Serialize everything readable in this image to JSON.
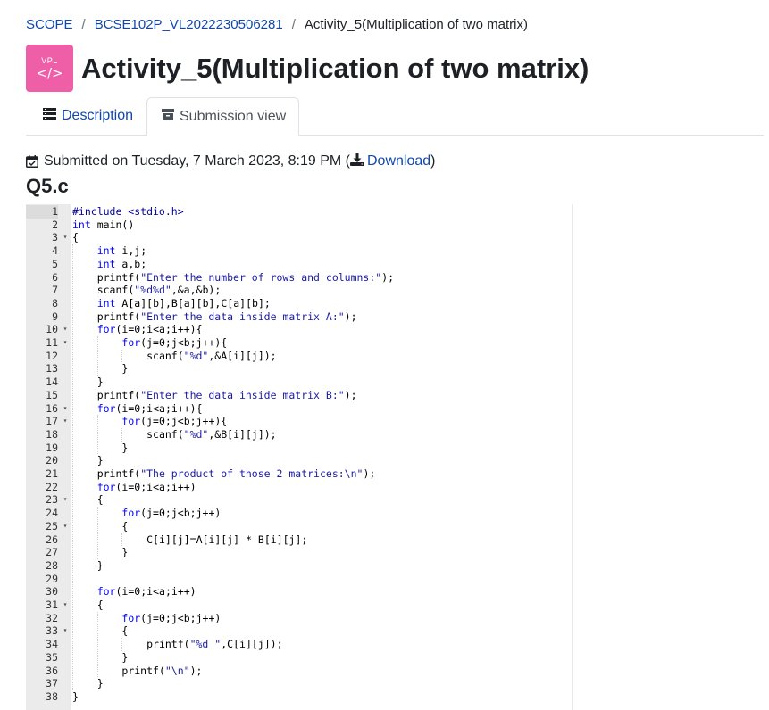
{
  "breadcrumb": {
    "items": [
      "SCOPE",
      "BCSE102P_VL2022230506281",
      "Activity_5(Multiplication of two matrix)"
    ],
    "separator": "/"
  },
  "header": {
    "icon_text": "VPL",
    "icon_glyph": "</>",
    "icon_color": "#ef5fa8",
    "title": "Activity_5(Multiplication of two matrix)"
  },
  "tabs": [
    {
      "label": "Description",
      "icon": "list-icon",
      "active": false
    },
    {
      "label": "Submission view",
      "icon": "archive-icon",
      "active": true
    }
  ],
  "submission": {
    "text": "Submitted on Tuesday, 7 March 2023, 8:19 PM (",
    "download_label": "Download",
    "close": ")",
    "filename": "Q5.c"
  },
  "colors": {
    "link": "#0f47ad",
    "accent": "#ef5fa8"
  },
  "editor": {
    "active_line": 1,
    "lines": [
      "#include <stdio.h>",
      "int main()",
      "{",
      "    int i,j;",
      "    int a,b;",
      "    printf(\"Enter the number of rows and columns:\");",
      "    scanf(\"%d%d\",&a,&b);",
      "    int A[a][b],B[a][b],C[a][b];",
      "    printf(\"Enter the data inside matrix A:\");",
      "    for(i=0;i<a;i++){",
      "        for(j=0;j<b;j++){",
      "            scanf(\"%d\",&A[i][j]);",
      "        }",
      "    }",
      "    printf(\"Enter the data inside matrix B:\");",
      "    for(i=0;i<a;i++){",
      "        for(j=0;j<b;j++){",
      "            scanf(\"%d\",&B[i][j]);",
      "        }",
      "    }",
      "    printf(\"The product of those 2 matrices:\\n\");",
      "    for(i=0;i<a;i++)",
      "    {",
      "        for(j=0;j<b;j++)",
      "        {",
      "            C[i][j]=A[i][j] * B[i][j];",
      "        }",
      "    }",
      "",
      "    for(i=0;i<a;i++)",
      "    {",
      "        for(j=0;j<b;j++)",
      "        {",
      "            printf(\"%d \",C[i][j]);",
      "        }",
      "        printf(\"\\n\");",
      "    }",
      "}"
    ],
    "fold_lines": [
      3,
      10,
      11,
      16,
      17,
      23,
      25,
      31,
      33
    ]
  }
}
